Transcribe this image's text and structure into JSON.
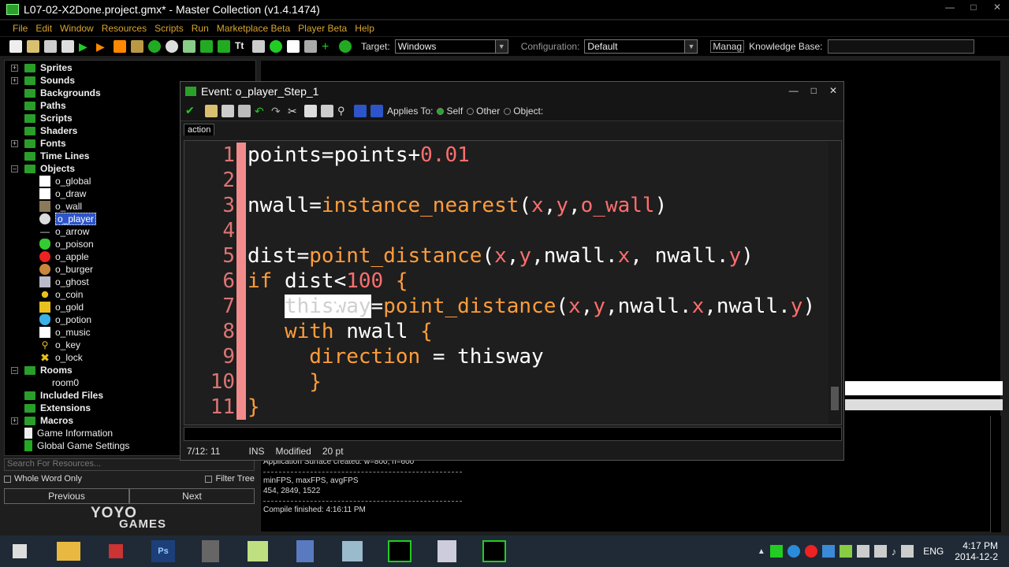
{
  "window": {
    "title": "L07-02-X2Done.project.gmx*  -  Master Collection (v1.4.1474)"
  },
  "menu": [
    "File",
    "Edit",
    "Window",
    "Resources",
    "Scripts",
    "Run",
    "Marketplace Beta",
    "Player Beta",
    "Help"
  ],
  "toolbar": {
    "target_label": "Target:",
    "target_value": "Windows",
    "config_label": "Configuration:",
    "config_value": "Default",
    "manage_label": "Manag",
    "kb_label": "Knowledge Base:"
  },
  "tree": {
    "folders": [
      "Sprites",
      "Sounds",
      "Backgrounds",
      "Paths",
      "Scripts",
      "Shaders",
      "Fonts",
      "Time Lines",
      "Objects"
    ],
    "objects": [
      "o_global",
      "o_draw",
      "o_wall",
      "o_player",
      "o_arrow",
      "o_poison",
      "o_apple",
      "o_burger",
      "o_ghost",
      "o_coin",
      "o_gold",
      "o_potion",
      "o_music",
      "o_key",
      "o_lock"
    ],
    "rooms_label": "Rooms",
    "room0": "room0",
    "extra": [
      "Included Files",
      "Extensions",
      "Macros",
      "Game Information",
      "Global Game Settings"
    ]
  },
  "search": {
    "placeholder": "Search For Resources...",
    "whole_word": "Whole Word Only",
    "filter_tree": "Filter Tree",
    "previous": "Previous",
    "next": "Next"
  },
  "branding": {
    "line1": "YOYO",
    "line2": "GAMES"
  },
  "event": {
    "title": "Event: o_player_Step_1",
    "applies_to": "Applies To:",
    "self": "Self",
    "other": "Other",
    "object": "Object:",
    "tab": "action",
    "status_pos": "7/12:  11",
    "status_mode": "INS",
    "status_mod": "Modified",
    "status_size": "20 pt"
  },
  "code_lines": [
    "1",
    "2",
    "3",
    "4",
    "5",
    "6",
    "7",
    "8",
    "9",
    "10",
    "11"
  ],
  "output": {
    "line1": "Application Surface created: w=800, h=600",
    "line2": "minFPS, maxFPS, avgFPS",
    "line3": "454, 2849, 1522",
    "line4": "Compile finished: 4:16:11 PM"
  },
  "taskbar": {
    "lang": "ENG",
    "time": "4:17 PM",
    "date": "2014-12-2"
  },
  "colors": {
    "accent": "#d9a52f",
    "selection": "#2d55c9",
    "marker": "#f28c8c"
  }
}
